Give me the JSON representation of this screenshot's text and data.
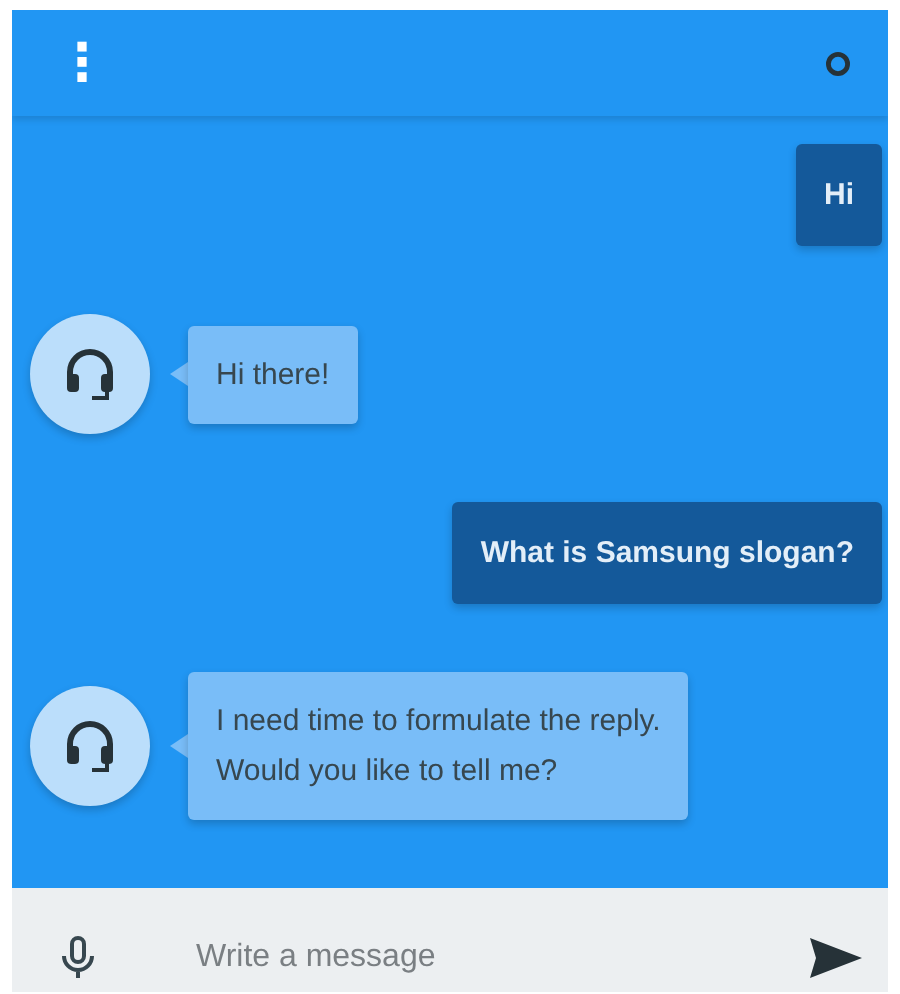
{
  "header": {
    "menu_label": "⋮"
  },
  "messages": [
    {
      "kind": "user",
      "text": "Hi"
    },
    {
      "kind": "bot",
      "text": "Hi there!"
    },
    {
      "kind": "user",
      "text": "What is Samsung slogan?"
    },
    {
      "kind": "bot",
      "text": "I need time to formulate the reply.\nWould you like to tell me?"
    }
  ],
  "composer": {
    "placeholder": "Write a message"
  }
}
